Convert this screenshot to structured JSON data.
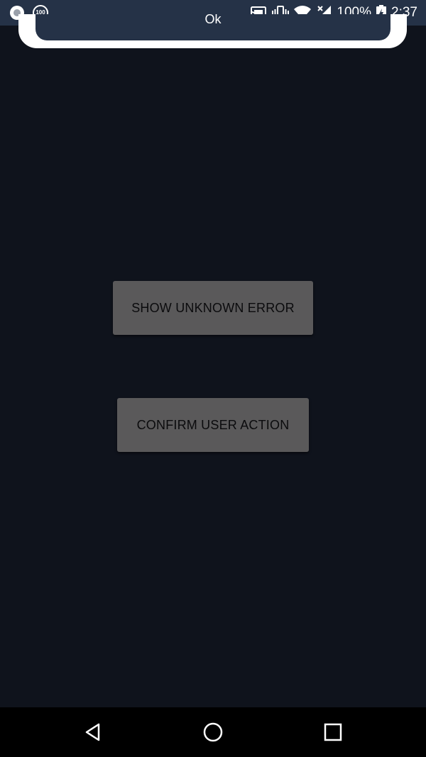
{
  "status_bar": {
    "left_icons": [
      "record-icon",
      "badge-100-icon"
    ],
    "badge_text": "100",
    "right_icons": [
      "cast-icon",
      "vibrate-icon",
      "wifi-icon",
      "signal-icon",
      "battery-icon"
    ],
    "battery": "100%",
    "time": "2:37"
  },
  "dialog": {
    "ok_label": "Ok"
  },
  "main": {
    "show_unknown_error_label": "SHOW UNKNOWN ERROR",
    "confirm_user_action_label": "CONFIRM USER ACTION"
  },
  "nav_bar": {
    "icons": [
      "back-icon",
      "home-icon",
      "recents-icon"
    ]
  },
  "colors": {
    "background": "#0f131c",
    "status_bar": "#253247",
    "button": "#5a595a",
    "nav_bar": "#000000"
  }
}
